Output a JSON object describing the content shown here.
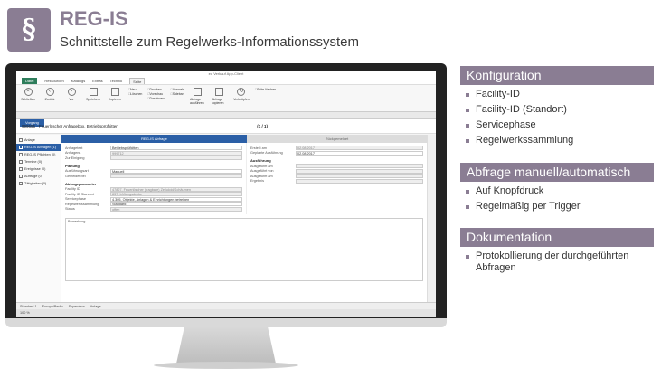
{
  "header": {
    "logo_symbol": "§",
    "title": "REG-IS",
    "subtitle": "Schnittstelle zum Regelwerks-Informationssystem"
  },
  "app": {
    "window_title": "eq Verkauf App-Client",
    "menu": [
      "Datei",
      "Ressourcen",
      "Katalogs",
      "Extras",
      "Technik",
      "Seite"
    ],
    "active_menu": "Seite",
    "ribbon_buttons": [
      {
        "label": "Schließen",
        "icon": "close-icon"
      },
      {
        "label": "Zurück",
        "icon": "back-icon"
      },
      {
        "label": "Vor",
        "icon": "forward-icon"
      },
      {
        "label": "Speichern",
        "icon": "save-icon"
      },
      {
        "label": "Kopieren",
        "icon": "copy-icon"
      }
    ],
    "ribbon_small": [
      "Neu",
      "Löschen",
      "Drucken",
      "Vorschau",
      "Dashboard",
      "Auswahl",
      "Sidebar"
    ],
    "ribbon_actions": [
      "Abfrage ausführen",
      "Abfrage kopieren",
      "Verknüpfen",
      "Seite löschen"
    ],
    "doc_tab": "Vorgang",
    "record_title": "999655 - Feuerlöscher Anfragebox, Betriebsprüfkitten",
    "pager": "(1 / 1)",
    "nav_items": [
      {
        "label": "Anlage",
        "selected": false
      },
      {
        "label": "REG-IS Abfragen (1)",
        "selected": true
      },
      {
        "label": "REG-IS Pflichten (0)",
        "selected": false
      },
      {
        "label": "Termine (0)",
        "selected": false
      },
      {
        "label": "Ereignisse (0)",
        "selected": false
      },
      {
        "label": "Aufträge (0)",
        "selected": false
      },
      {
        "label": "Tätigkeiten (0)",
        "selected": false
      }
    ],
    "section_left": "REG-IS Abfrage",
    "section_right": "Rückgemeldet",
    "fields_top": [
      {
        "k": "Anfragetext",
        "v": "Betriebsprüfkitten"
      },
      {
        "k": "Anfragenr.",
        "v": "999712"
      },
      {
        "k": "Zur Einigung",
        "v": ""
      }
    ],
    "group_planung": "Planung",
    "fields_planung": [
      {
        "k": "Ausführungsart",
        "v": "Manuell"
      },
      {
        "k": "Gemeldet bei",
        "v": ""
      }
    ],
    "group_params": "Abfrageparameter",
    "fields_params": [
      {
        "k": "Facility ID",
        "v": "47827, Feuerlöscher (tragbare) Zelluloid/Schäumen"
      },
      {
        "k": "Facility ID Standort",
        "v": "837, Lüftungsdecke"
      },
      {
        "k": "Servicephase",
        "v": "4.305, Objekte, Anlagen & Einrichtungen betreiben"
      },
      {
        "k": "Regelwerkssammlung",
        "v": "Standard"
      },
      {
        "k": "Status",
        "v": "offen"
      }
    ],
    "bemerkung_label": "Bemerkung",
    "right_fields": [
      {
        "k": "Erstellt am",
        "v": "02.08.2017"
      },
      {
        "k": "Geplante Ausführung",
        "v": "02.08.2017"
      }
    ],
    "group_ausfuehrung": "Ausführung",
    "fields_ausfuehrung": [
      {
        "k": "Ausgeführt am",
        "v": ""
      },
      {
        "k": "Ausgeführt von",
        "v": ""
      },
      {
        "k": "Ausgeführt am",
        "v": ""
      },
      {
        "k": "Ergebnis",
        "v": ""
      }
    ],
    "status_items": [
      "Standard 1",
      "Europe/Berlin",
      "Supervisor",
      "Anlage"
    ],
    "zoom": "100 %"
  },
  "panels": [
    {
      "title": "Konfiguration",
      "items": [
        "Facility-ID",
        "Facility-ID (Standort)",
        "Servicephase",
        "Regelwerkssammlung"
      ]
    },
    {
      "title": "Abfrage manuell/automatisch",
      "items": [
        "Auf Knopfdruck",
        "Regelmäßig per Trigger"
      ]
    },
    {
      "title": "Dokumentation",
      "items": [
        "Protokollierung der durchgeführten Abfragen"
      ]
    }
  ],
  "colors": {
    "accent": "#8a7d93",
    "app_blue": "#2b5fa6"
  }
}
